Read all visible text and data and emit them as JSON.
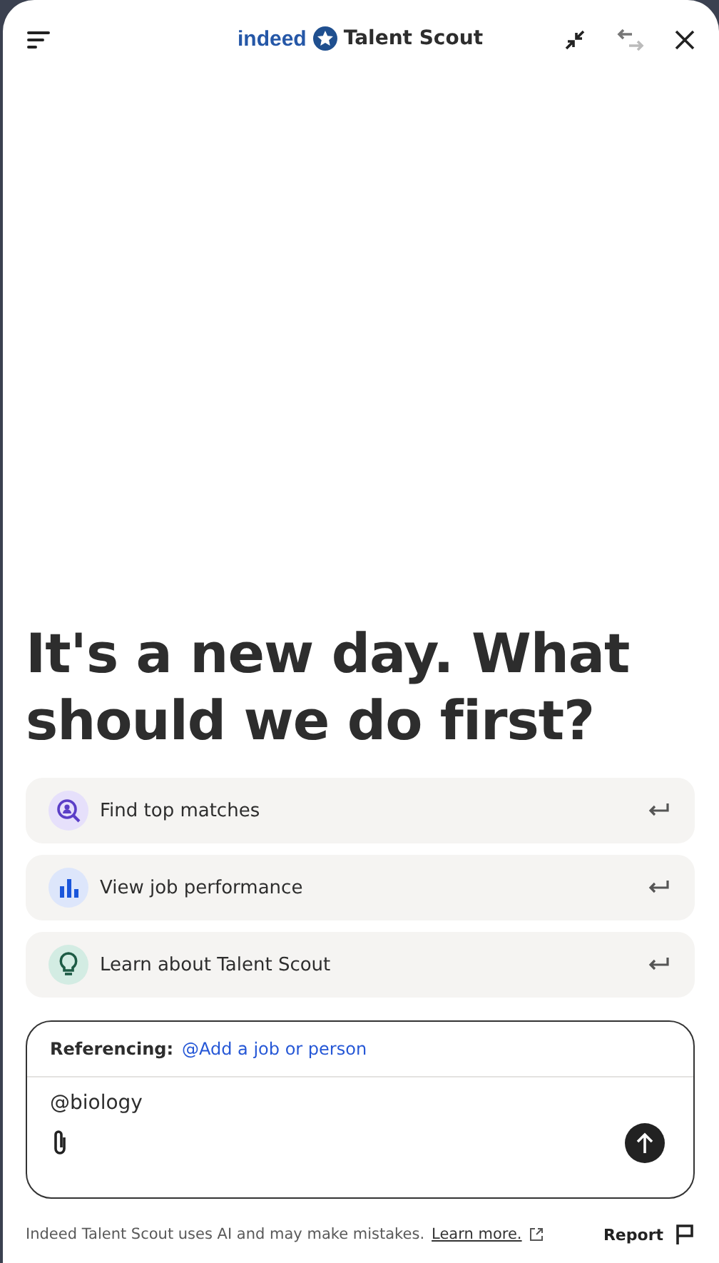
{
  "header": {
    "logo": "indeed",
    "title": "Talent Scout"
  },
  "heading": "It's a new day. What should we do first?",
  "suggestions": [
    {
      "kind": "search",
      "label": "Find top matches"
    },
    {
      "kind": "chart",
      "label": "View job performance"
    },
    {
      "kind": "idea",
      "label": "Learn about Talent Scout"
    }
  ],
  "composer": {
    "referencing_label": "Referencing:",
    "referencing_link": "@Add a job or person",
    "value": "@biology"
  },
  "footer": {
    "disclaimer": "Indeed Talent Scout uses AI and may make mistakes.",
    "link": "Learn more.",
    "report": "Report"
  }
}
